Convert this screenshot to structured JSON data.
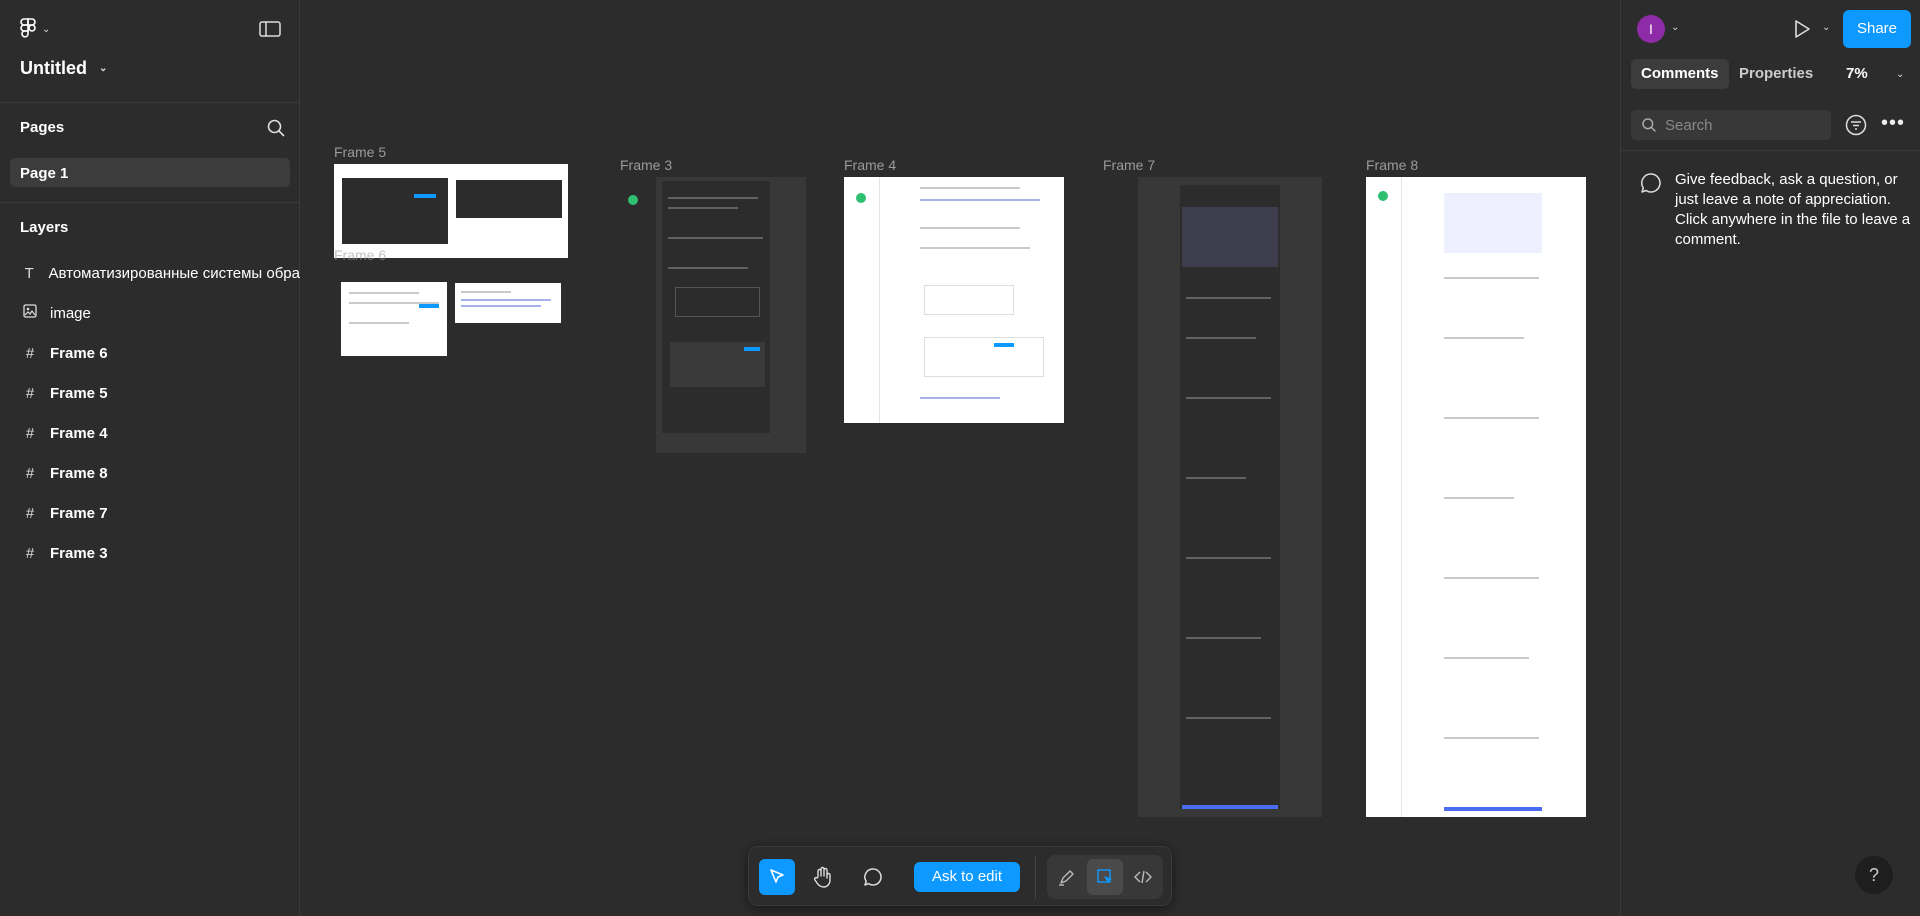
{
  "file": {
    "title": "Untitled"
  },
  "pages": {
    "heading": "Pages",
    "items": [
      {
        "label": "Page 1"
      }
    ]
  },
  "layers": {
    "heading": "Layers",
    "items": [
      {
        "type": "text",
        "label": "Автоматизированные системы обра"
      },
      {
        "type": "image",
        "label": "image"
      },
      {
        "type": "frame",
        "label": "Frame 6"
      },
      {
        "type": "frame",
        "label": "Frame 5"
      },
      {
        "type": "frame",
        "label": "Frame 4"
      },
      {
        "type": "frame",
        "label": "Frame 8"
      },
      {
        "type": "frame",
        "label": "Frame 7"
      },
      {
        "type": "frame",
        "label": "Frame 3"
      }
    ]
  },
  "canvas": {
    "frames": [
      {
        "label": "Frame 5"
      },
      {
        "label": "Frame 6"
      },
      {
        "label": "Frame 3"
      },
      {
        "label": "Frame 4"
      },
      {
        "label": "Frame 7"
      },
      {
        "label": "Frame 8"
      }
    ]
  },
  "right_panel": {
    "avatar_initial": "I",
    "share_label": "Share",
    "tabs": [
      "Comments",
      "Properties"
    ],
    "active_tab": "Comments",
    "zoom": "7%",
    "search_placeholder": "Search",
    "hint": "Give feedback, ask a question, or just leave a note of appreciation. Click anywhere in the file to leave a comment.",
    "help_label": "?"
  },
  "toolbar": {
    "ask_label": "Ask to edit"
  },
  "colors": {
    "accent": "#0d99ff",
    "avatar": "#8e2ba6",
    "background": "#2c2c2c"
  }
}
